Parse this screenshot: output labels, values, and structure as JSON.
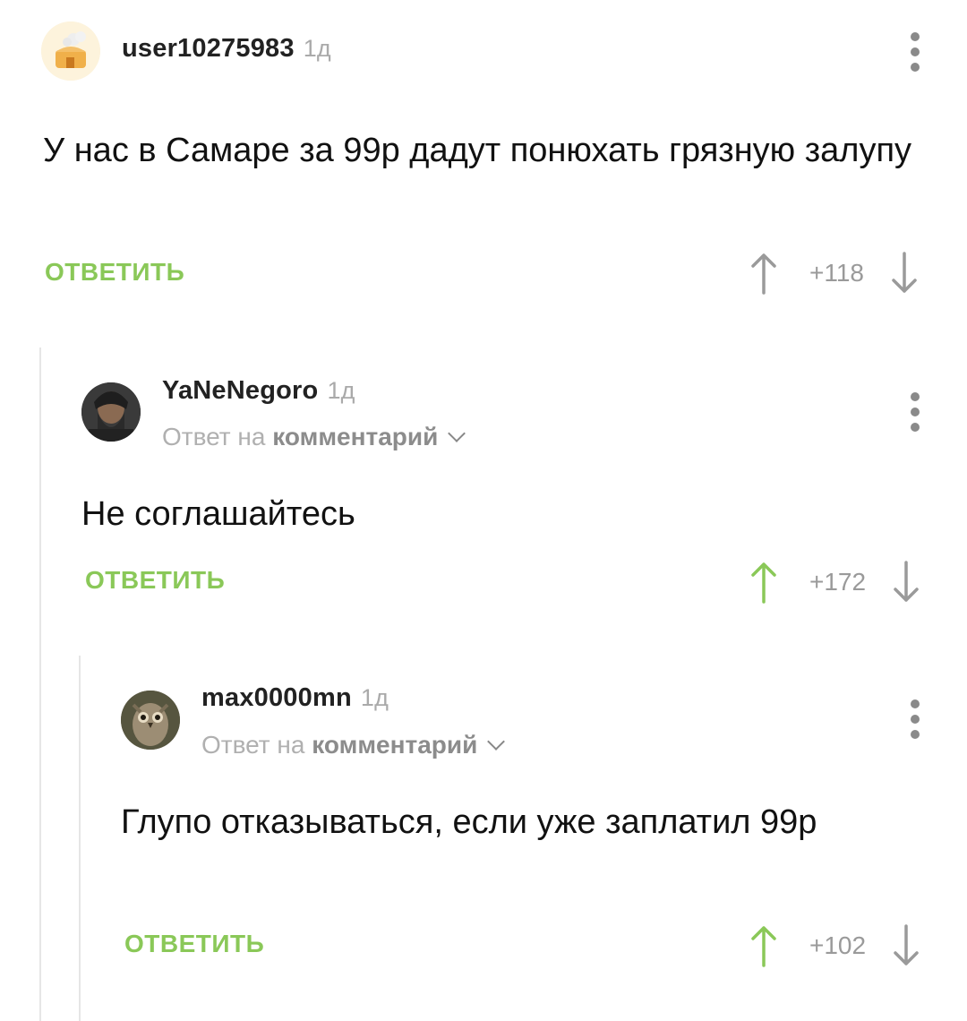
{
  "comments": [
    {
      "username": "user10275983",
      "time": "1д",
      "text": "У нас в Самаре за 99р дадут понюхать грязную залупу",
      "reply_label": "ОТВЕТИТЬ",
      "score": "+118",
      "upvoted": false
    },
    {
      "username": "YaNeNegoro",
      "time": "1д",
      "reply_prefix": "Ответ на",
      "reply_link": "комментарий",
      "text": "Не соглашайтесь",
      "reply_label": "ОТВЕТИТЬ",
      "score": "+172",
      "upvoted": true
    },
    {
      "username": "max0000mn",
      "time": "1д",
      "reply_prefix": "Ответ на",
      "reply_link": "комментарий",
      "text": "Глупо отказываться, если уже заплатил 99р",
      "reply_label": "ОТВЕТИТЬ",
      "score": "+102",
      "upvoted": true
    }
  ],
  "colors": {
    "accent_green": "#8ac858",
    "upvote_active": "#8ac858",
    "muted_gray": "#9a9a9a"
  },
  "icons": [
    "more-vertical-icon",
    "upvote-arrow-icon",
    "downvote-arrow-icon",
    "chevron-down-icon"
  ]
}
